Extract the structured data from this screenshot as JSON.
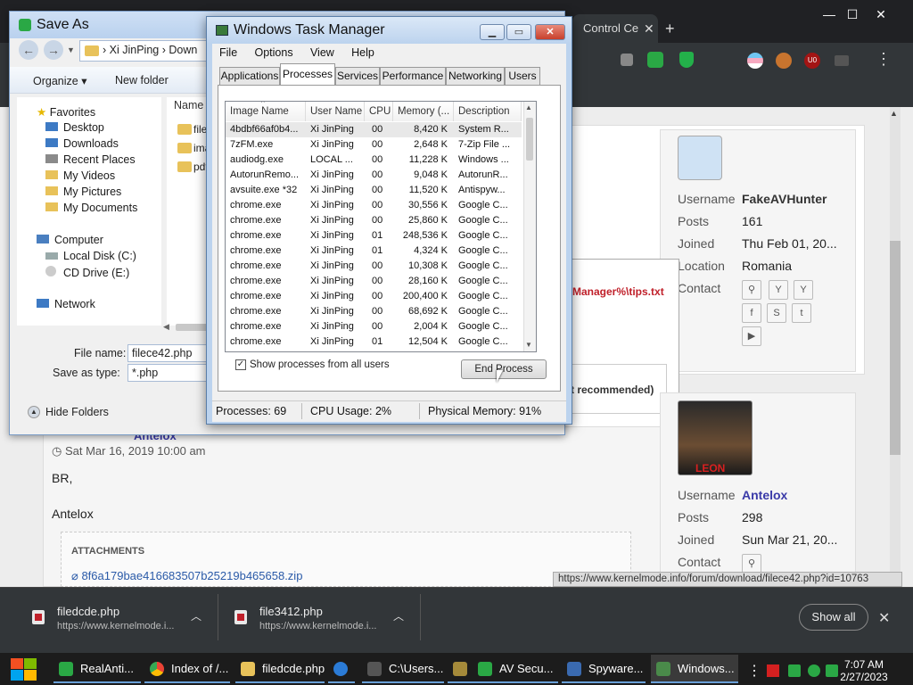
{
  "browser": {
    "tabs": [
      {
        "label": "Control Ce"
      }
    ],
    "status_url": "https://www.kernelmode.info/forum/download/filece42.php?id=10763",
    "ext_badge": "U0"
  },
  "page": {
    "popup_text": "Manager%\\tips.txt",
    "popup_button": "t recommended)",
    "post_date": "Sat Mar 16, 2019 10:00 am",
    "post_line1": "BR,",
    "post_line2": "Antelox",
    "post_author_partial": "Antelox",
    "attachments_label": "ATTACHMENTS",
    "attachment_file": "8f6a179bae416683507b25219b465658.zip",
    "profile1": {
      "username_label": "Username",
      "username": "FakeAVHunter",
      "posts_label": "Posts",
      "posts": "161",
      "joined_label": "Joined",
      "joined": "Thu Feb 01, 20...",
      "location_label": "Location",
      "location": "Romania",
      "contact_label": "Contact"
    },
    "profile2": {
      "username_label": "Username",
      "username": "Antelox",
      "posts_label": "Posts",
      "posts": "298",
      "joined_label": "Joined",
      "joined": "Sun Mar 21, 20...",
      "contact_label": "Contact",
      "avatar_text": "LEON"
    }
  },
  "downloads": {
    "items": [
      {
        "name": "filedcde.php",
        "url": "https://www.kernelmode.i..."
      },
      {
        "name": "file3412.php",
        "url": "https://www.kernelmode.i..."
      }
    ],
    "show_all": "Show all"
  },
  "saveas": {
    "title": "Save As",
    "breadcrumb": [
      "Xi JinPing",
      "Down"
    ],
    "organize": "Organize",
    "new_folder": "New folder",
    "col_name": "Name",
    "files": [
      "file",
      "ima",
      "pdf"
    ],
    "tree": {
      "favorites": "Favorites",
      "desktop": "Desktop",
      "downloads": "Downloads",
      "recent": "Recent Places",
      "videos": "My Videos",
      "pictures": "My Pictures",
      "documents": "My Documents",
      "computer": "Computer",
      "local_disk": "Local Disk (C:)",
      "cd_drive": "CD Drive (E:)",
      "network": "Network"
    },
    "file_name_label": "File name:",
    "file_name_value": "filece42.php",
    "save_type_label": "Save as type:",
    "save_type_value": "*.php",
    "hide_folders": "Hide Folders"
  },
  "taskmgr": {
    "title": "Windows Task Manager",
    "menu": [
      "File",
      "Options",
      "View",
      "Help"
    ],
    "tabs": [
      "Applications",
      "Processes",
      "Services",
      "Performance",
      "Networking",
      "Users"
    ],
    "active_tab": "Processes",
    "columns": [
      "Image Name",
      "User Name",
      "CPU",
      "Memory (...",
      "Description"
    ],
    "rows": [
      [
        "4bdbf66af0b4...",
        "Xi JinPing",
        "00",
        "8,420 K",
        "System R..."
      ],
      [
        "7zFM.exe",
        "Xi JinPing",
        "00",
        "2,648 K",
        "7-Zip File ..."
      ],
      [
        "audiodg.exe",
        "LOCAL ...",
        "00",
        "11,228 K",
        "Windows ..."
      ],
      [
        "AutorunRemo...",
        "Xi JinPing",
        "00",
        "9,048 K",
        "AutorunR..."
      ],
      [
        "avsuite.exe *32",
        "Xi JinPing",
        "00",
        "11,520 K",
        "Antispyw..."
      ],
      [
        "chrome.exe",
        "Xi JinPing",
        "00",
        "30,556 K",
        "Google C..."
      ],
      [
        "chrome.exe",
        "Xi JinPing",
        "00",
        "25,860 K",
        "Google C..."
      ],
      [
        "chrome.exe",
        "Xi JinPing",
        "01",
        "248,536 K",
        "Google C..."
      ],
      [
        "chrome.exe",
        "Xi JinPing",
        "01",
        "4,324 K",
        "Google C..."
      ],
      [
        "chrome.exe",
        "Xi JinPing",
        "00",
        "10,308 K",
        "Google C..."
      ],
      [
        "chrome.exe",
        "Xi JinPing",
        "00",
        "28,160 K",
        "Google C..."
      ],
      [
        "chrome.exe",
        "Xi JinPing",
        "00",
        "200,400 K",
        "Google C..."
      ],
      [
        "chrome.exe",
        "Xi JinPing",
        "00",
        "68,692 K",
        "Google C..."
      ],
      [
        "chrome.exe",
        "Xi JinPing",
        "00",
        "2,004 K",
        "Google C..."
      ],
      [
        "chrome.exe",
        "Xi JinPing",
        "01",
        "12,504 K",
        "Google C..."
      ]
    ],
    "show_all_users": "Show processes from all users",
    "end_process": "End Process",
    "status": {
      "processes": "Processes: 69",
      "cpu": "CPU Usage: 2%",
      "memory": "Physical Memory: 91%"
    }
  },
  "taskbar": {
    "items": [
      "RealAnti...",
      "Index of /...",
      "filedcde.php",
      "",
      "C:\\Users...",
      "",
      "AV Secu...",
      "Spyware...",
      "Windows..."
    ],
    "time": "7:07 AM",
    "date": "2/27/2023"
  },
  "colors": {
    "accent": "#3a3aa8",
    "danger": "#c0202a",
    "chrome_dark": "#323639"
  }
}
